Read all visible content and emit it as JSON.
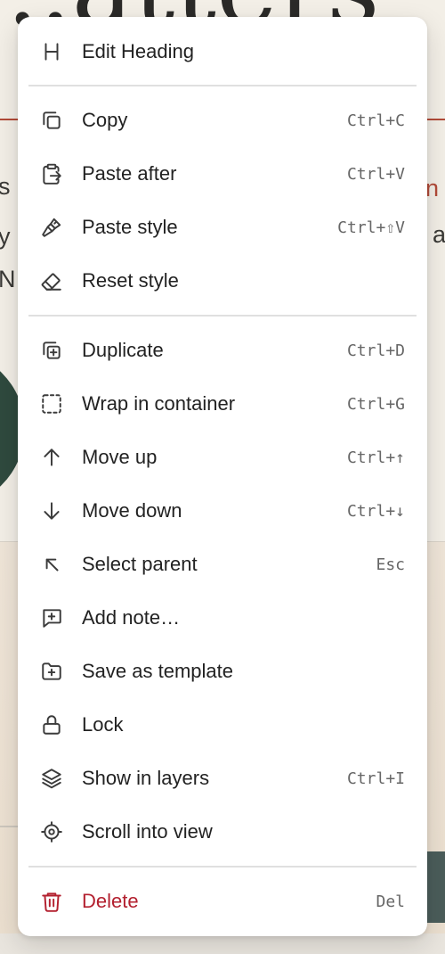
{
  "background": {
    "heading_fragment": "...atters",
    "heading_right_fragment": "e",
    "left_fragments": [
      "s",
      "y",
      "N"
    ],
    "right_fragments": [
      "n r",
      "a"
    ]
  },
  "menu": {
    "heading_item": {
      "label": "Edit Heading",
      "icon": "heading-icon"
    },
    "groups": [
      [
        {
          "label": "Copy",
          "shortcut": "Ctrl+C",
          "icon": "copy-icon"
        },
        {
          "label": "Paste after",
          "shortcut": "Ctrl+V",
          "icon": "paste-icon"
        },
        {
          "label": "Paste style",
          "shortcut": "Ctrl+⇧V",
          "icon": "brush-icon"
        },
        {
          "label": "Reset style",
          "shortcut": "",
          "icon": "eraser-icon"
        }
      ],
      [
        {
          "label": "Duplicate",
          "shortcut": "Ctrl+D",
          "icon": "duplicate-icon"
        },
        {
          "label": "Wrap in container",
          "shortcut": "Ctrl+G",
          "icon": "dashed-square-icon"
        },
        {
          "label": "Move up",
          "shortcut": "Ctrl+↑",
          "icon": "arrow-up-icon"
        },
        {
          "label": "Move down",
          "shortcut": "Ctrl+↓",
          "icon": "arrow-down-icon"
        },
        {
          "label": "Select parent",
          "shortcut": "Esc",
          "icon": "arrow-up-left-icon"
        },
        {
          "label": "Add note…",
          "shortcut": "",
          "icon": "add-note-icon"
        },
        {
          "label": "Save as template",
          "shortcut": "",
          "icon": "folder-plus-icon"
        },
        {
          "label": "Lock",
          "shortcut": "",
          "icon": "lock-icon"
        },
        {
          "label": "Show in layers",
          "shortcut": "Ctrl+I",
          "icon": "layers-icon"
        },
        {
          "label": "Scroll into view",
          "shortcut": "",
          "icon": "locate-icon"
        }
      ]
    ],
    "delete_item": {
      "label": "Delete",
      "shortcut": "Del",
      "icon": "trash-icon"
    },
    "colors": {
      "danger": "#b3202f",
      "text": "#222222",
      "shortcut": "#666666"
    }
  }
}
